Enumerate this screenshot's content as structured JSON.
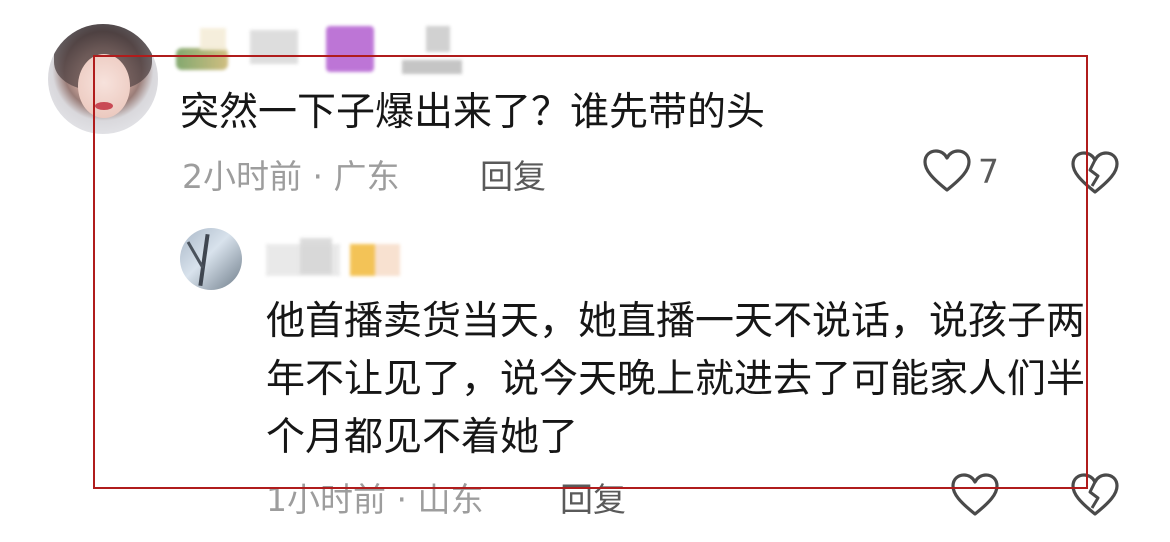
{
  "comment": {
    "avatar_icon": "user-avatar-photo",
    "text": "突然一下子爆出来了？谁先带的头",
    "time": "2小时前 · 广东",
    "reply_label": "回复",
    "like_count": "7",
    "like_icon": "heart-outline-icon",
    "dislike_icon": "broken-heart-icon"
  },
  "reply": {
    "avatar_icon": "user-avatar-photo",
    "text": "他首播卖货当天，她直播一天不说话，说孩子两年不让见了，说今天晚上就进去了可能家人们半个月都见不着她了",
    "time": "1小时前 · 山东",
    "reply_label": "回复",
    "like_icon": "heart-outline-icon",
    "dislike_icon": "broken-heart-icon"
  },
  "colors": {
    "text_primary": "#161616",
    "text_meta": "#9d9d9d",
    "reply_button": "#5a5a5a",
    "annotation_border": "#b01c1c"
  }
}
